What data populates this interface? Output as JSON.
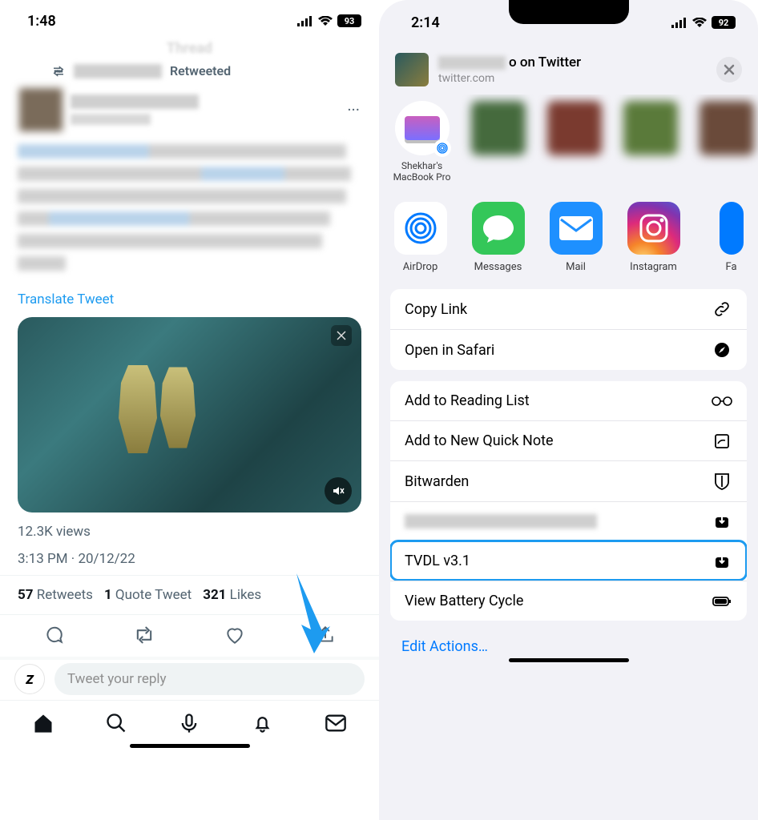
{
  "left": {
    "status": {
      "time": "1:48",
      "battery": "93"
    },
    "header_title": "Thread",
    "retweeted_label": "Retweeted",
    "translate": "Translate Tweet",
    "views": "12.3K views",
    "timestamp": "3:13 PM · 20/12/22",
    "stats": {
      "retweets_n": "57",
      "retweets_l": "Retweets",
      "quote_n": "1",
      "quote_l": "Quote Tweet",
      "likes_n": "321",
      "likes_l": "Likes"
    },
    "reply_placeholder": "Tweet your reply"
  },
  "right": {
    "status": {
      "time": "2:14",
      "battery": "92"
    },
    "sheet": {
      "title_suffix": "o on Twitter",
      "subtitle": "twitter.com"
    },
    "airdrop_device": "Shekhar's MacBook Pro",
    "apps": {
      "airdrop": "AirDrop",
      "messages": "Messages",
      "mail": "Mail",
      "instagram": "Instagram",
      "facebook": "Fa"
    },
    "actions": {
      "copy_link": "Copy Link",
      "open_safari": "Open in Safari",
      "reading_list": "Add to Reading List",
      "quick_note": "Add to New Quick Note",
      "bitwarden": "Bitwarden",
      "tvdl": "TVDL v3.1",
      "battery_cycle": "View Battery Cycle"
    },
    "edit": "Edit Actions…"
  }
}
